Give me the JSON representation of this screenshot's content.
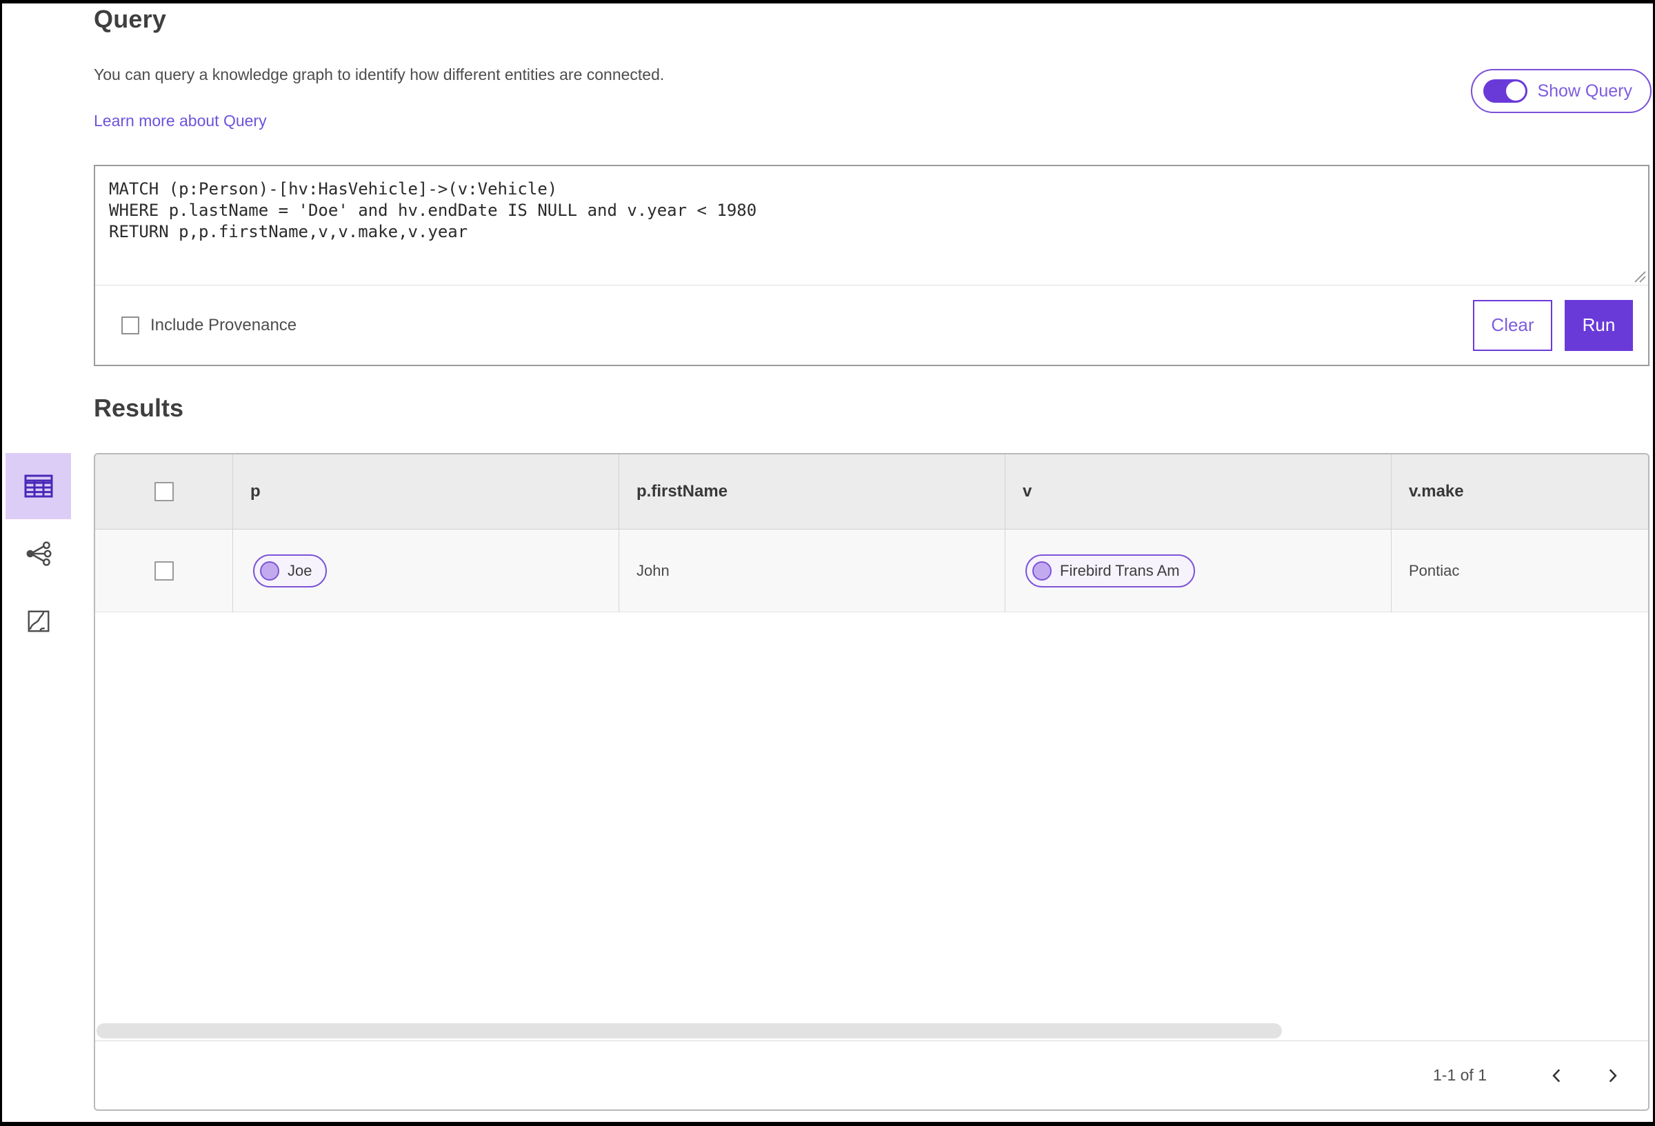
{
  "header": {
    "title": "Query",
    "description": "You can query a knowledge graph to identify how different entities are connected.",
    "learn_more_label": "Learn more about Query",
    "show_query_label": "Show Query",
    "show_query_on": true
  },
  "query_editor": {
    "query_text": "MATCH (p:Person)-[hv:HasVehicle]->(v:Vehicle)\nWHERE p.lastName = 'Doe' and hv.endDate IS NULL and v.year < 1980\nRETURN p,p.firstName,v,v.make,v.year",
    "include_provenance_label": "Include Provenance",
    "include_provenance_checked": false,
    "clear_label": "Clear",
    "run_label": "Run"
  },
  "results": {
    "title": "Results",
    "view_switcher": [
      {
        "icon": "table-view-icon",
        "selected": true
      },
      {
        "icon": "link-chart-view-icon",
        "selected": false
      },
      {
        "icon": "map-view-icon",
        "selected": false
      }
    ],
    "table": {
      "columns": [
        {
          "label": "p"
        },
        {
          "label": "p.firstName"
        },
        {
          "label": "v"
        },
        {
          "label": "v.make"
        }
      ],
      "rows": [
        {
          "cells": [
            {
              "kind": "entity-pill",
              "label": "Joe"
            },
            {
              "kind": "text",
              "label": "John"
            },
            {
              "kind": "entity-pill",
              "label": "Firebird Trans Am"
            },
            {
              "kind": "text",
              "label": "Pontiac"
            }
          ]
        }
      ]
    },
    "pagination": {
      "range_label": "1-1 of 1"
    }
  },
  "colors": {
    "brand_purple": "#6a3ad9",
    "link_purple": "#6d53dc",
    "pill_border": "#7d55d9",
    "pill_fill": "#f7f3fd",
    "selected_view_bg": "#dccdf6",
    "table_header_bg": "#ececec"
  }
}
